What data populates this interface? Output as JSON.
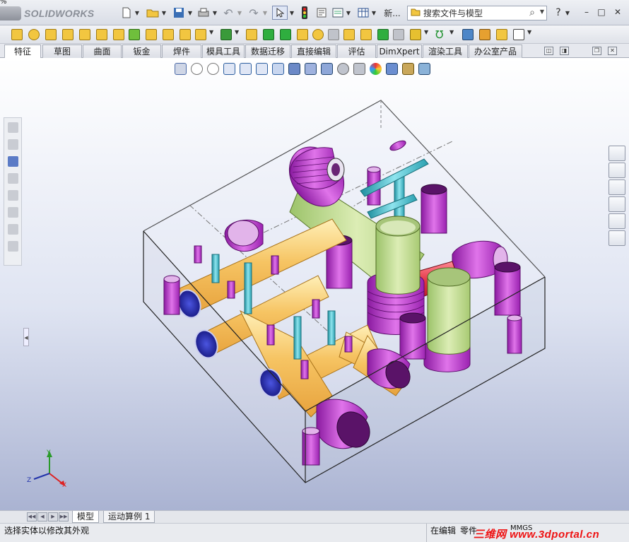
{
  "app": {
    "corner_text": "%",
    "logo_text": "SOLIDWORKS",
    "title_new_label": "新...",
    "search_placeholder": "搜索文件与模型",
    "help_label": "?"
  },
  "window_controls": [
    "–",
    "□",
    "✕"
  ],
  "tabs": [
    {
      "label": "特征",
      "active": true
    },
    {
      "label": "草图",
      "active": false
    },
    {
      "label": "曲面",
      "active": false
    },
    {
      "label": "钣金",
      "active": false
    },
    {
      "label": "焊件",
      "active": false
    },
    {
      "label": "模具工具",
      "active": false
    },
    {
      "label": "数据迁移",
      "active": false
    },
    {
      "label": "直接编辑",
      "active": false
    },
    {
      "label": "评估",
      "active": false
    },
    {
      "label": "DimXpert",
      "active": false
    },
    {
      "label": "渲染工具",
      "active": false
    },
    {
      "label": "办公室产品",
      "active": false
    }
  ],
  "triad": {
    "x": "X",
    "y": "Y",
    "z": "Z"
  },
  "sheet_tabs": [
    "模型",
    "运动算例 1"
  ],
  "status": {
    "left": "选择实体以修改其外观",
    "editing": "在编辑",
    "doc_type": "零件",
    "units": "MMGS",
    "watermark": "三维网 www.3dportal.cn"
  },
  "colors": {
    "yellow_pipe": "#f2c05a",
    "green_pipe": "#b5d67c",
    "magenta_port": "#c02ed0",
    "cyan_pin": "#39b8c6",
    "red_pipe": "#e03548",
    "blue_cap": "#2b2fb0"
  }
}
